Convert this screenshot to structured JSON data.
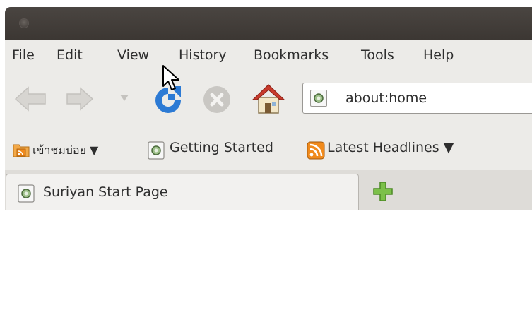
{
  "menubar": {
    "items": [
      {
        "pre": "",
        "key": "F",
        "post": "ile"
      },
      {
        "pre": "",
        "key": "E",
        "post": "dit"
      },
      {
        "pre": "",
        "key": "V",
        "post": "iew"
      },
      {
        "pre": "Hi",
        "key": "s",
        "post": "tory"
      },
      {
        "pre": "",
        "key": "B",
        "post": "ookmarks"
      },
      {
        "pre": "",
        "key": "T",
        "post": "ools"
      },
      {
        "pre": "",
        "key": "H",
        "post": "elp"
      }
    ]
  },
  "navbar": {
    "url": "about:home",
    "icons": [
      "back-arrow-icon",
      "forward-arrow-icon",
      "history-dropdown-icon",
      "reload-icon",
      "stop-icon",
      "home-icon"
    ]
  },
  "bookmarks": {
    "items": [
      {
        "label": "เข้าชมบ่อย ▼",
        "icon": "folder-rss-icon"
      },
      {
        "label": "Getting Started",
        "icon": "page-icon"
      },
      {
        "label": "Latest Headlines ▼",
        "icon": "rss-icon"
      }
    ]
  },
  "tabs": {
    "items": [
      {
        "title": "Suriyan Start Page"
      }
    ],
    "new_tab_icon": "plus-icon"
  },
  "colors": {
    "titlebar": "#3f3a36",
    "chrome": "#ecebe8",
    "rss": "#f08a1c",
    "reload": "#2c7ad4",
    "home_roof": "#c83a2c",
    "new_tab": "#7cc04a"
  }
}
